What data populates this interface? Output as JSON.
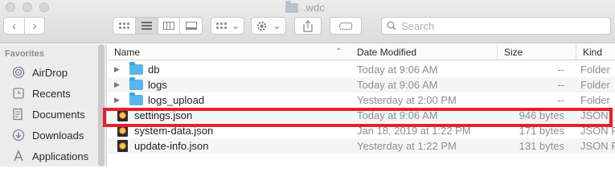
{
  "window": {
    "title": ".wdc"
  },
  "toolbar": {
    "back_glyph": "‹",
    "forward_glyph": "›",
    "group_arrow": "⌄",
    "action_arrow": "⌄",
    "search": {
      "placeholder": "Search"
    },
    "icons": [
      "chevron-left-icon",
      "chevron-right-icon",
      "icon-view-icon",
      "list-view-icon",
      "column-view-icon",
      "gallery-view-icon",
      "group-icon",
      "gear-icon",
      "share-icon",
      "tag-icon",
      "search-icon"
    ]
  },
  "sidebar": {
    "heading": "Favorites",
    "items": [
      {
        "label": "AirDrop",
        "icon": "airdrop-icon",
        "glyph": "◉"
      },
      {
        "label": "Recents",
        "icon": "clock-icon",
        "glyph": "🕓"
      },
      {
        "label": "Documents",
        "icon": "document-icon",
        "glyph": "▤"
      },
      {
        "label": "Downloads",
        "icon": "download-icon",
        "glyph": "⬇"
      },
      {
        "label": "Applications",
        "icon": "applications-icon",
        "glyph": "A"
      }
    ]
  },
  "columns": {
    "name": "Name",
    "date": "Date Modified",
    "size": "Size",
    "kind": "Kind"
  },
  "files": [
    {
      "name": "db",
      "date": "Today at 9:06 AM",
      "size": "--",
      "kind": "Folder",
      "type": "folder"
    },
    {
      "name": "logs",
      "date": "Today at 9:06 AM",
      "size": "--",
      "kind": "Folder",
      "type": "folder"
    },
    {
      "name": "logs_upload",
      "date": "Yesterday at 2:00 PM",
      "size": "--",
      "kind": "Folder",
      "type": "folder"
    },
    {
      "name": "settings.json",
      "date": "Today at 9:06 AM",
      "size": "946 bytes",
      "kind": "JSON",
      "type": "json"
    },
    {
      "name": "system-data.json",
      "date": "Jan 18, 2019 at 1:22 PM",
      "size": "171 bytes",
      "kind": "JSON F",
      "type": "json"
    },
    {
      "name": "update-info.json",
      "date": "Yesterday at 1:22 PM",
      "size": "131 bytes",
      "kind": "JSON F",
      "type": "json"
    }
  ],
  "highlight": {
    "row": "settings.json",
    "color": "#e8202a"
  },
  "colors": {
    "folder": "#57b7ec",
    "sidebar_bg": "#ececec",
    "toolbar_bg": "#dcdcdc"
  }
}
